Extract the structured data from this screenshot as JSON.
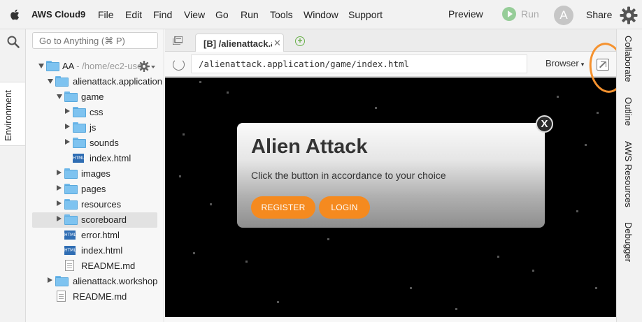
{
  "menubar": {
    "brand": "AWS Cloud9",
    "items": [
      "File",
      "Edit",
      "Find",
      "View",
      "Go",
      "Run",
      "Tools",
      "Window",
      "Support"
    ],
    "preview": "Preview",
    "run": "Run",
    "avatar_initial": "A",
    "share": "Share"
  },
  "left_strip": {
    "environment_tab": "Environment"
  },
  "tree": {
    "goto_placeholder": "Go to Anything (⌘ P)",
    "root_name": "AA",
    "root_path": " - /home/ec2-use",
    "rows": [
      {
        "label": "alienattack.application"
      },
      {
        "label": "game"
      },
      {
        "label": "css"
      },
      {
        "label": "js"
      },
      {
        "label": "sounds"
      },
      {
        "label": "index.html"
      },
      {
        "label": "images"
      },
      {
        "label": "pages"
      },
      {
        "label": "resources"
      },
      {
        "label": "scoreboard"
      },
      {
        "label": "error.html"
      },
      {
        "label": "index.html"
      },
      {
        "label": "README.md"
      },
      {
        "label": "alienattack.workshop"
      },
      {
        "label": "README.md"
      }
    ],
    "html_icon_text": "HTML"
  },
  "editor": {
    "tab_title": "[B] /alienattack.a",
    "url": "/alienattack.application/game/index.html",
    "browser_dropdown": "Browser"
  },
  "game": {
    "title": "Alien Attack",
    "message": "Click the button in accordance to your choice",
    "close": "X",
    "register": "REGISTER",
    "login": "LOGIN"
  },
  "right_strip": {
    "tabs": [
      "Collaborate",
      "Outline",
      "AWS Resources",
      "Debugger"
    ]
  },
  "colors": {
    "accent_orange": "#f58a1f",
    "annotation_orange": "#f5922f",
    "folder_blue": "#7ec3f0",
    "run_green": "#4caf50"
  }
}
